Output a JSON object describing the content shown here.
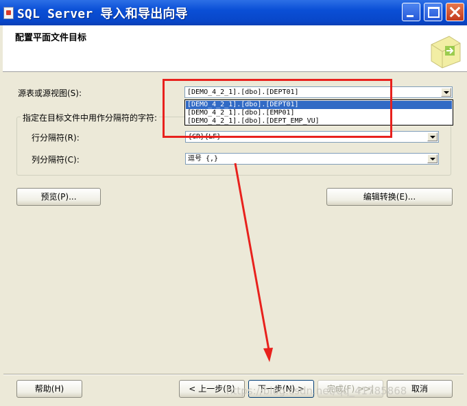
{
  "window": {
    "title": "SQL Server 导入和导出向导",
    "title_bar_color": "#0a4fd6",
    "controls": [
      "minimize-icon",
      "maximize-icon",
      "close-icon"
    ]
  },
  "header": {
    "title": "配置平面文件目标"
  },
  "source": {
    "label": "源表或源视图(S):",
    "value": "[DEMO_4_2_1].[dbo].[DEPT01]",
    "options": [
      "[DEMO_4_2_1].[dbo].[DEPT01]",
      "[DEMO_4_2_1].[dbo].[EMP01]",
      "[DEMO_4_2_1].[dbo].[DEPT_EMP_VU]"
    ],
    "selected_color": "#316ac5"
  },
  "delimiters": {
    "group_title": "指定在目标文件中用作分隔符的字符:",
    "row_label": "行分隔符(R):",
    "row_value": "{CR}{LF}",
    "col_label": "列分隔符(C):",
    "col_value": "逗号 {,}"
  },
  "buttons": {
    "preview": "预览(P)...",
    "edit_mappings": "编辑转换(E)...",
    "help": "帮助(H)",
    "back": "< 上一步(B)",
    "next": "下一步(N) >",
    "finish": "完成(F) >>|",
    "cancel": "取消"
  },
  "annotation": {
    "color": "#e8211d"
  },
  "watermark": "https://blog.csdn.net/qq_41785868"
}
